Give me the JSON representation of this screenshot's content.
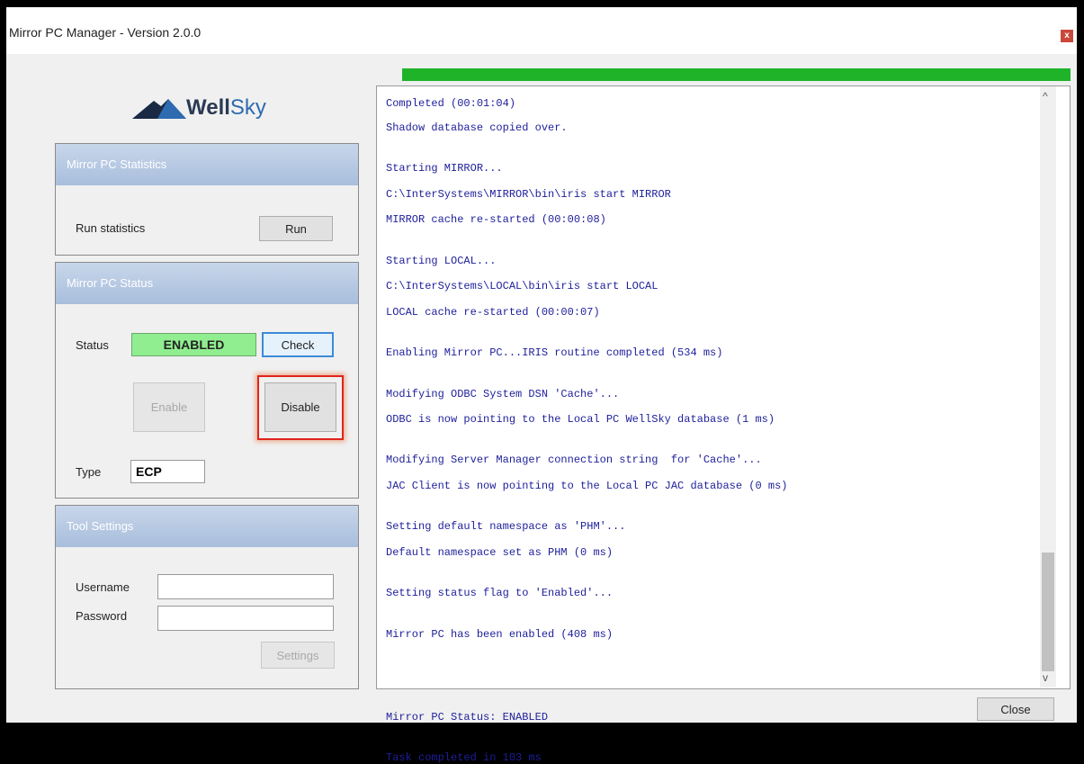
{
  "window": {
    "title": "Mirror PC Manager - Version 2.0.0",
    "close_glyph": "x"
  },
  "logo": {
    "text_a": "Well",
    "text_b": "Sky",
    "icon": "mountain-icon"
  },
  "statistics": {
    "header": "Mirror PC Statistics",
    "run_label": "Run statistics",
    "run_button": "Run"
  },
  "status_panel": {
    "header": "Mirror PC Status",
    "status_label": "Status",
    "status_value": "ENABLED",
    "check_button": "Check",
    "enable_button": "Enable",
    "disable_button": "Disable",
    "type_label": "Type",
    "type_value": "ECP"
  },
  "settings": {
    "header": "Tool Settings",
    "username_label": "Username",
    "username_value": "",
    "password_label": "Password",
    "password_value": "",
    "settings_button": "Settings"
  },
  "progress": {
    "value": 1.0
  },
  "log": [
    "Completed (00:01:04)",
    "Shadow database copied over.",
    "Starting MIRROR...",
    "C:\\InterSystems\\MIRROR\\bin\\iris start MIRROR",
    "MIRROR cache re-started (00:00:08)",
    "Starting LOCAL...",
    "C:\\InterSystems\\LOCAL\\bin\\iris start LOCAL",
    "LOCAL cache re-started (00:00:07)",
    "Enabling Mirror PC...IRIS routine completed (534 ms)",
    "Modifying ODBC System DSN 'Cache'...",
    "ODBC is now pointing to the Local PC WellSky database (1 ms)",
    "Modifying Server Manager connection string  for 'Cache'...",
    "JAC Client is now pointing to the Local PC JAC database (0 ms)",
    "Setting default namespace as 'PHM'...",
    "Default namespace set as PHM (0 ms)",
    "Setting status flag to 'Enabled'...",
    "Mirror PC has been enabled (408 ms)",
    "Mirror PC Status: ENABLED",
    "Task completed in 103 ms"
  ],
  "scrollbar": {
    "up_glyph": "^",
    "down_glyph": "v"
  },
  "footer": {
    "close_button": "Close"
  },
  "colors": {
    "accent_green": "#1fb32a",
    "status_green": "#90ee90",
    "log_text": "#1d1e9a",
    "highlight": "#e0241c"
  }
}
